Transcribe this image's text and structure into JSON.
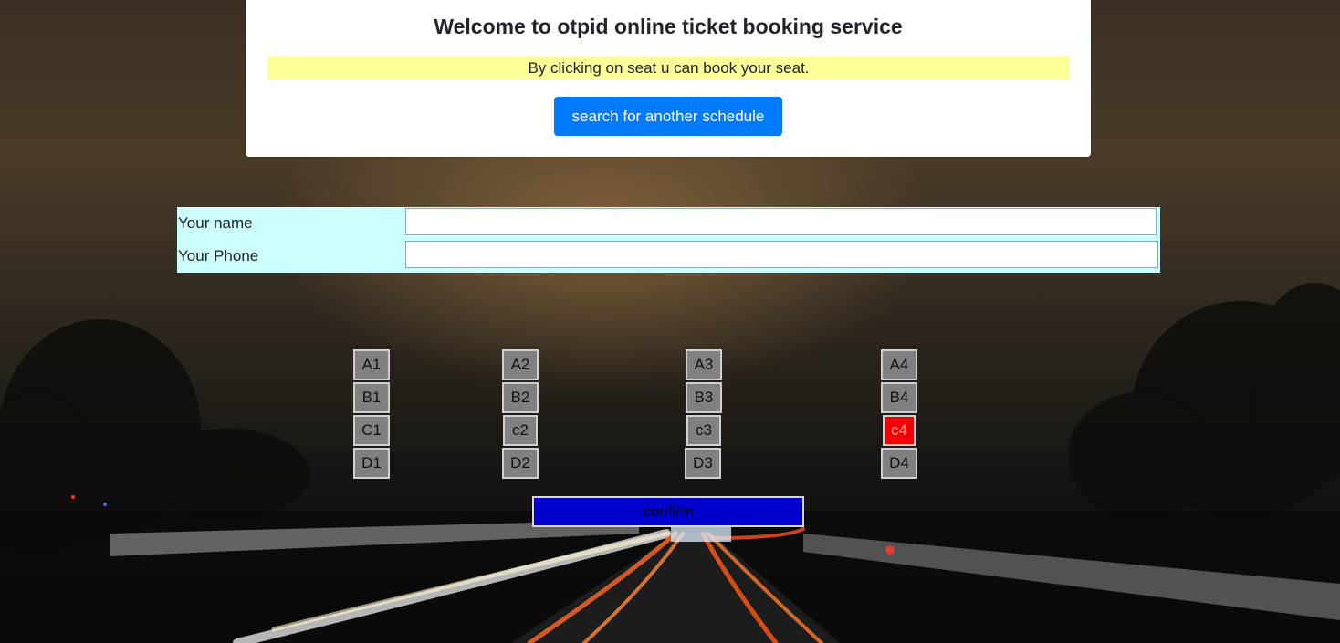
{
  "header": {
    "title": "Welcome to otpid online ticket booking service",
    "note": "By clicking on seat u can book your seat.",
    "search_button": "search for another schedule"
  },
  "form": {
    "name_label": "Your name",
    "name_value": "",
    "phone_label": "Your Phone",
    "phone_value": ""
  },
  "seats": {
    "A1": "A1",
    "A2": "A2",
    "A3": "A3",
    "A4": "A4",
    "B1": "B1",
    "B2": "B2",
    "B3": "B3",
    "B4": "B4",
    "C1": "C1",
    "C2": "c2",
    "C3": "c3",
    "C4": "c4",
    "D1": "D1",
    "D2": "D2",
    "D3": "D3",
    "D4": "D4"
  },
  "booked_seats": [
    "c4"
  ],
  "confirm_button": "confirm",
  "colors": {
    "primary": "#007bff",
    "note_bg": "#ffff99",
    "form_bg": "#ccffff",
    "seat_available": "#808080",
    "seat_booked": "#ee0000",
    "confirm_bg": "#0000cc"
  }
}
